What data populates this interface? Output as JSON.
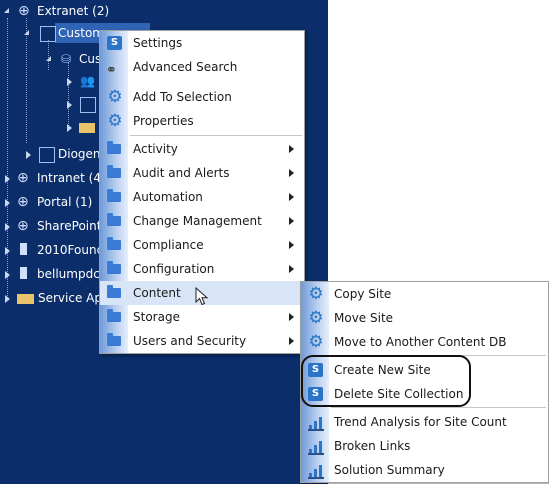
{
  "tree": {
    "nodes": [
      {
        "label": "Extranet (2)",
        "icon": "globe-icon"
      },
      {
        "label": "Custom",
        "icon": "site-collection-icon"
      },
      {
        "label": "Cus",
        "icon": "site-icon"
      },
      {
        "label": "",
        "icon": "users-icon"
      },
      {
        "label": "",
        "icon": "image-icon"
      },
      {
        "label": "",
        "icon": "folder-icon"
      },
      {
        "label": "Diogen",
        "icon": "site-collection-icon"
      },
      {
        "label": "Intranet (4)",
        "icon": "globe-icon"
      },
      {
        "label": "Portal (1)",
        "icon": "globe-icon"
      },
      {
        "label": "SharePoint",
        "icon": "globe-icon"
      },
      {
        "label": "2010Found",
        "icon": "server-icon"
      },
      {
        "label": "bellumpdc",
        "icon": "server-icon"
      },
      {
        "label": "Service Ap",
        "icon": "folder-icon"
      }
    ]
  },
  "context_menu": {
    "items": [
      {
        "label": "Settings",
        "icon": "sharepoint-icon",
        "submenu": false
      },
      {
        "label": "Advanced Search",
        "icon": "binoculars-icon",
        "submenu": false
      },
      {
        "label": "Add To Selection",
        "icon": "gear-icon",
        "submenu": false
      },
      {
        "label": "Properties",
        "icon": "gear-icon",
        "submenu": false
      },
      {
        "label": "Activity",
        "icon": "folder-icon",
        "submenu": true
      },
      {
        "label": "Audit and Alerts",
        "icon": "folder-icon",
        "submenu": true
      },
      {
        "label": "Automation",
        "icon": "folder-icon",
        "submenu": true
      },
      {
        "label": "Change Management",
        "icon": "folder-icon",
        "submenu": true
      },
      {
        "label": "Compliance",
        "icon": "folder-icon",
        "submenu": true
      },
      {
        "label": "Configuration",
        "icon": "folder-icon",
        "submenu": true
      },
      {
        "label": "Content",
        "icon": "folder-icon",
        "submenu": true,
        "highlighted": true
      },
      {
        "label": "Storage",
        "icon": "folder-icon",
        "submenu": true
      },
      {
        "label": "Users and Security",
        "icon": "folder-icon",
        "submenu": true
      }
    ]
  },
  "content_submenu": {
    "items": [
      {
        "label": "Copy Site",
        "icon": "gear-icon"
      },
      {
        "label": "Move Site",
        "icon": "gear-icon"
      },
      {
        "label": "Move to Another Content DB",
        "icon": "gear-icon"
      },
      {
        "label": "Create New Site",
        "icon": "sharepoint-icon"
      },
      {
        "label": "Delete Site Collection",
        "icon": "sharepoint-icon"
      },
      {
        "label": "Trend Analysis for Site Count",
        "icon": "bar-chart-icon"
      },
      {
        "label": "Broken Links",
        "icon": "bar-chart-icon"
      },
      {
        "label": "Solution Summary",
        "icon": "bar-chart-icon"
      }
    ]
  },
  "colors": {
    "tree_bg": "#0b2e6b",
    "accent": "#2b74c8",
    "highlight": "#d8e5f7"
  }
}
